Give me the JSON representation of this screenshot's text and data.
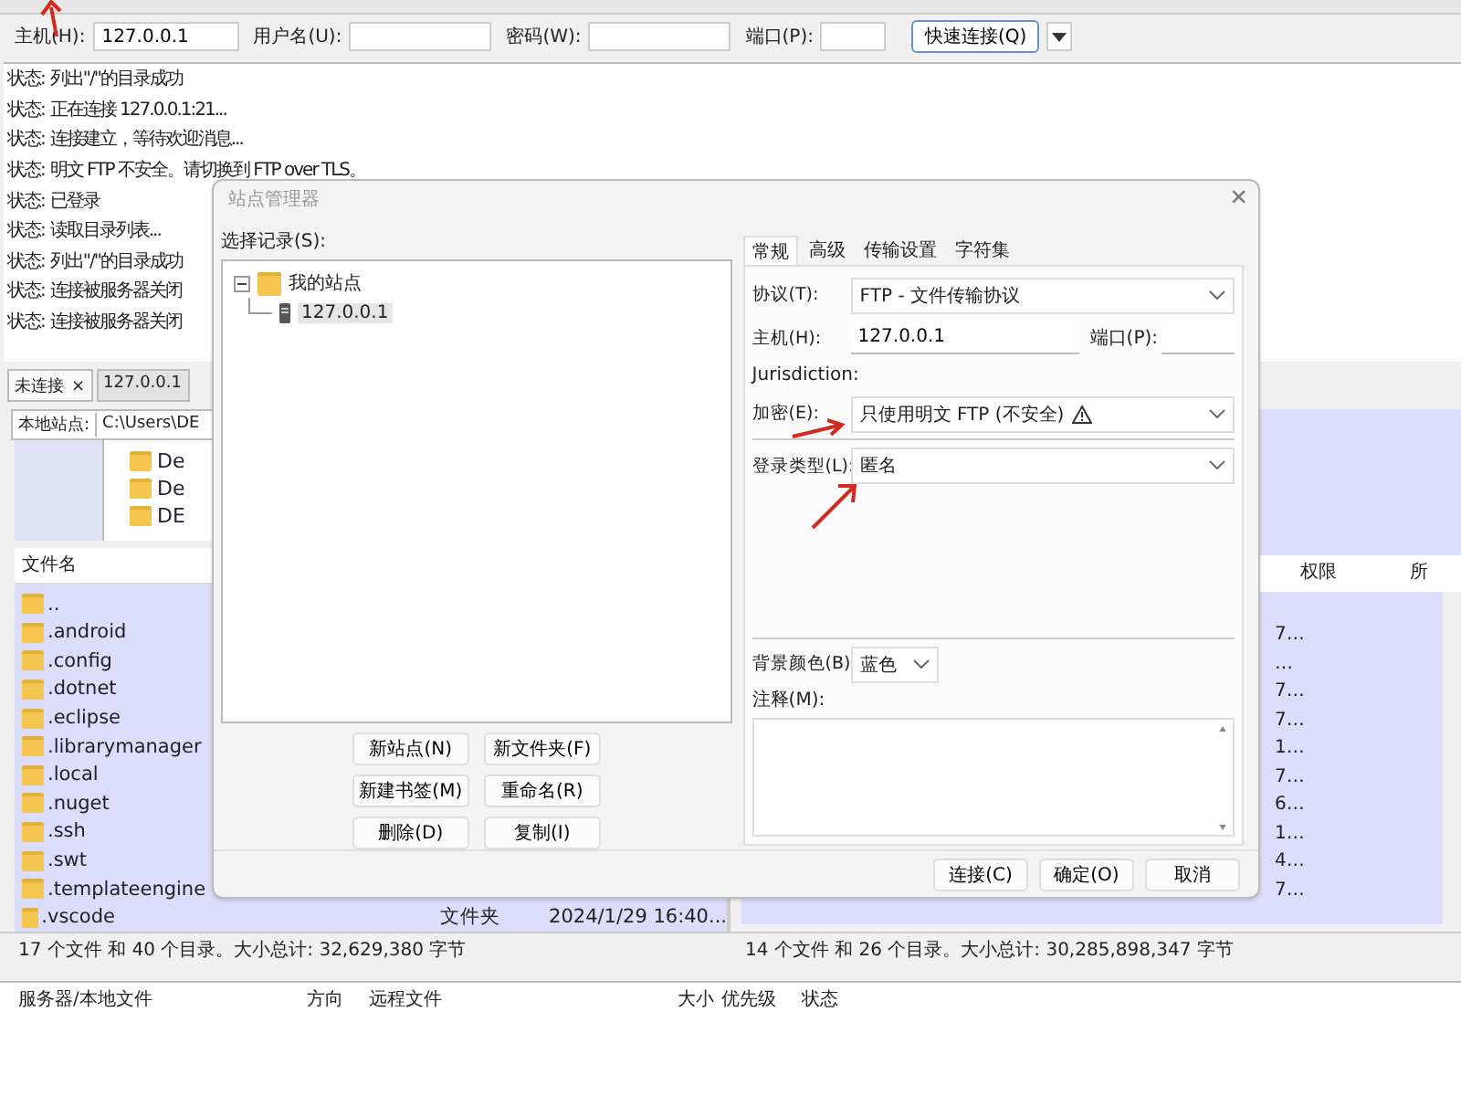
{
  "quick_connect": {
    "fields": [
      {
        "label": "主机(H):",
        "value": "127.0.0.1"
      },
      {
        "label": "用户名(U):"
      },
      {
        "label": "密码(W):"
      },
      {
        "label": "端口(P):"
      }
    ],
    "button": "快速连接(Q)"
  },
  "log": [
    {
      "label": "状态:",
      "text": "列出\"/\"的目录成功"
    },
    {
      "label": "状态:",
      "text": "正在连接 127.0.0.1:21..."
    },
    {
      "label": "状态:",
      "text": "连接建立，等待欢迎消息..."
    },
    {
      "label": "状态:",
      "text": "明文 FTP 不安全。请切换到 FTP over TLS。"
    },
    {
      "label": "状态:",
      "text": "已登录"
    },
    {
      "label": "状态:",
      "text": "读取目录列表..."
    },
    {
      "label": "状态:",
      "text": "列出\"/\"的目录成功"
    },
    {
      "label": "状态:",
      "text": "连接被服务器关闭"
    },
    {
      "label": "状态:",
      "text": "连接被服务器关闭"
    }
  ],
  "tabs": [
    {
      "label": "未连接",
      "close": "×",
      "selected": true
    },
    {
      "label": "127.0.0.1",
      "selected": false
    }
  ],
  "local": {
    "path_label": "本地站点:",
    "path": "C:\\Users\\DE",
    "tree": [
      "De",
      "De",
      "DE"
    ],
    "columns": [
      "文件名"
    ],
    "files": [
      {
        "name": ".."
      },
      {
        "name": ".android"
      },
      {
        "name": ".config"
      },
      {
        "name": ".dotnet"
      },
      {
        "name": ".eclipse"
      },
      {
        "name": ".librarymanager"
      },
      {
        "name": ".local"
      },
      {
        "name": ".nuget"
      },
      {
        "name": ".ssh"
      },
      {
        "name": ".swt"
      },
      {
        "name": ".templateengine"
      },
      {
        "name": ".vscode",
        "type": "文件夹",
        "modified": "2024/1/29 16:40..."
      }
    ],
    "status": "17 个文件 和 40 个目录。大小总计: 32,629,380 字节"
  },
  "remote": {
    "columns": [
      "权限",
      "所"
    ],
    "values": [
      "7…",
      "…",
      "7…",
      "7…",
      "1…",
      "7…",
      "6…",
      "1…",
      "4…",
      "7…"
    ],
    "status": "14 个文件 和 26 个目录。大小总计: 30,285,898,347 字节"
  },
  "queue": {
    "columns": [
      "服务器/本地文件",
      "方向",
      "远程文件",
      "大小",
      "优先级",
      "状态"
    ]
  },
  "dialog": {
    "title": "站点管理器",
    "close": "×",
    "select_label": "选择记录(S):",
    "tree": [
      {
        "label": "我的站点",
        "expanded": true,
        "children": [
          {
            "label": "127.0.0.1",
            "selected": true
          }
        ]
      }
    ],
    "buttons": [
      "新站点(N)",
      "新文件夹(F)",
      "新建书签(M)",
      "重命名(R)",
      "删除(D)",
      "复制(I)"
    ],
    "tabs": [
      {
        "label": "常规",
        "selected": true
      },
      {
        "label": "高级",
        "selected": false
      },
      {
        "label": "传输设置",
        "selected": false
      },
      {
        "label": "字符集",
        "selected": false
      }
    ],
    "protocol": {
      "label": "协议(T):",
      "value": "FTP - 文件传输协议"
    },
    "host": {
      "label": "主机(H):",
      "value": "127.0.0.1"
    },
    "port": {
      "label": "端口(P):"
    },
    "jurisdiction": "Jurisdiction:",
    "encryption": {
      "label": "加密(E):",
      "value": "只使用明文 FTP (不安全)",
      "warning": true
    },
    "logon_type": {
      "label": "登录类型(L):",
      "value": "匿名"
    },
    "background": {
      "label": "背景颜色(B)",
      "value": "蓝色"
    },
    "comments": {
      "label": "注释(M):"
    },
    "footer_buttons": [
      "连接(C)",
      "确定(O)",
      "取消"
    ]
  }
}
